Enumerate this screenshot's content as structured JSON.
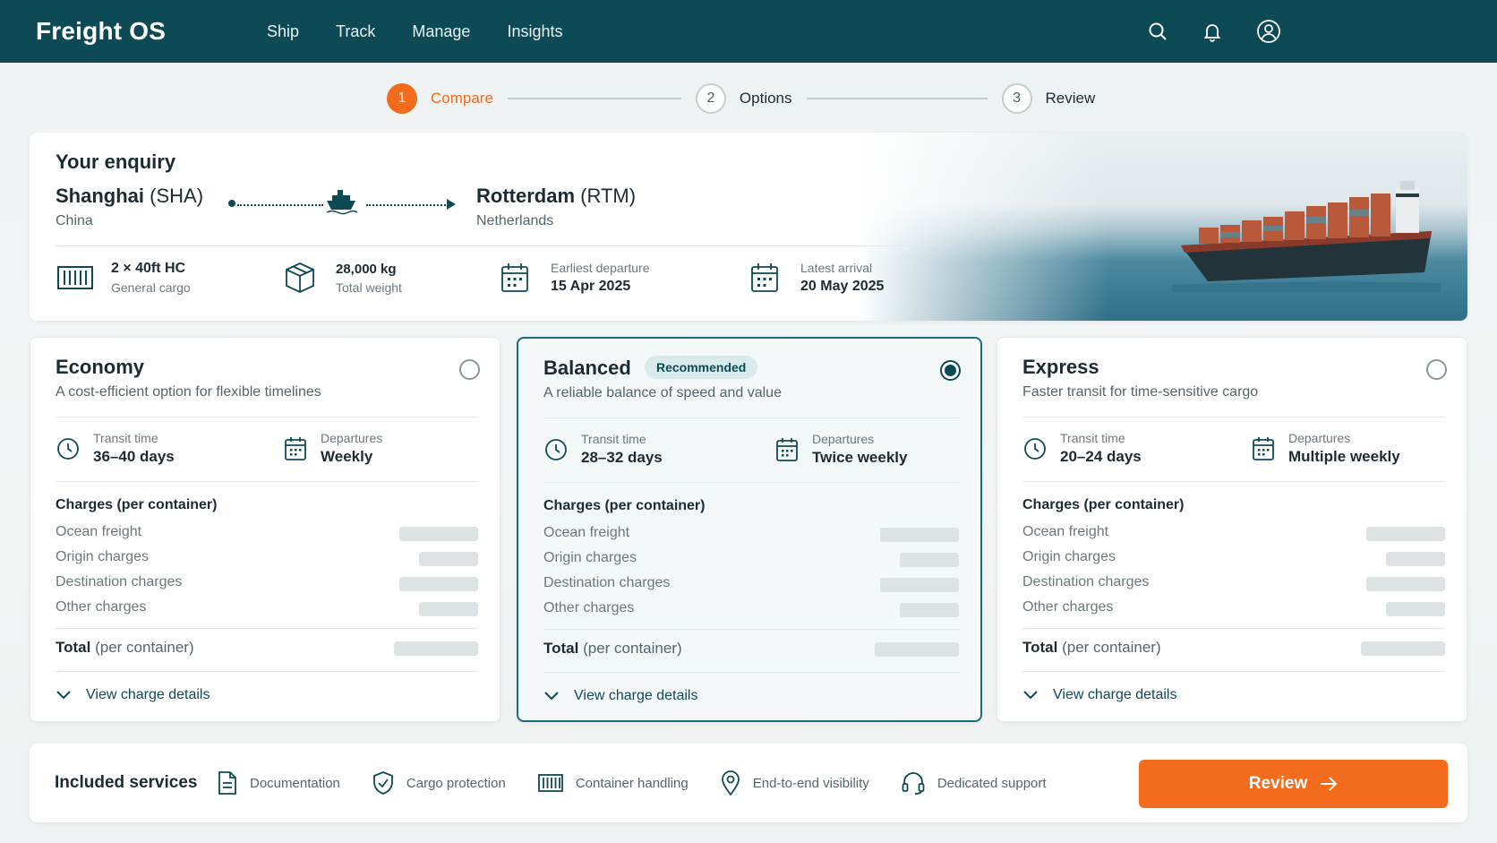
{
  "app": {
    "brand": "Freight OS"
  },
  "nav": {
    "items": [
      "Ship",
      "Track",
      "Manage",
      "Insights"
    ],
    "icons": [
      "search-icon",
      "bell-icon",
      "user-icon"
    ]
  },
  "stepper": {
    "steps": [
      {
        "number": "1",
        "label": "Compare",
        "state": "active"
      },
      {
        "number": "2",
        "label": "Options",
        "state": "inactive"
      },
      {
        "number": "3",
        "label": "Review",
        "state": "inactive"
      }
    ]
  },
  "enquiry": {
    "title": "Your enquiry",
    "origin": {
      "city": "Shanghai",
      "code": "(SHA)",
      "country": "China"
    },
    "destination": {
      "city": "Rotterdam",
      "code": "(RTM)",
      "country": "Netherlands"
    },
    "cargo": {
      "main": "2 × 40ft HC",
      "sub": "General cargo"
    },
    "weight": {
      "main": "28,000 kg",
      "sub": "Total weight"
    },
    "departure": {
      "label": "Earliest departure",
      "value": "15 Apr 2025"
    },
    "arrival": {
      "label": "Latest arrival",
      "value": "20 May 2025"
    }
  },
  "options": [
    {
      "name": "Economy",
      "badge": "",
      "selected": false,
      "description": "A cost-efficient option for flexible timelines",
      "transit_label": "Transit time",
      "transit": "36–40 days",
      "departures_label": "Departures",
      "departures": "Weekly",
      "charges_title": "Charges (per container)",
      "charges": [
        "Ocean freight",
        "Origin charges",
        "Destination charges",
        "Other charges"
      ],
      "total_bold": "Total",
      "total_rest": " (per container)",
      "details": "View charge details"
    },
    {
      "name": "Balanced",
      "badge": "Recommended",
      "selected": true,
      "description": "A reliable balance of speed and value",
      "transit_label": "Transit time",
      "transit": "28–32 days",
      "departures_label": "Departures",
      "departures": "Twice weekly",
      "charges_title": "Charges (per container)",
      "charges": [
        "Ocean freight",
        "Origin charges",
        "Destination charges",
        "Other charges"
      ],
      "total_bold": "Total",
      "total_rest": " (per container)",
      "details": "View charge details"
    },
    {
      "name": "Express",
      "badge": "",
      "selected": false,
      "description": "Faster transit for time-sensitive cargo",
      "transit_label": "Transit time",
      "transit": "20–24 days",
      "departures_label": "Departures",
      "departures": "Multiple weekly",
      "charges_title": "Charges (per container)",
      "charges": [
        "Ocean freight",
        "Origin charges",
        "Destination charges",
        "Other charges"
      ],
      "total_bold": "Total",
      "total_rest": " (per container)",
      "details": "View charge details"
    }
  ],
  "services": {
    "title": "Included services",
    "items": [
      {
        "label": "Documentation",
        "icon": "document-icon"
      },
      {
        "label": "Cargo protection",
        "icon": "shield-icon"
      },
      {
        "label": "Container handling",
        "icon": "container-icon"
      },
      {
        "label": "End-to-end visibility",
        "icon": "location-pin-icon"
      },
      {
        "label": "Dedicated support",
        "icon": "headset-icon"
      }
    ],
    "cta": "Review"
  },
  "colors": {
    "nav": "#0e4a55",
    "accent": "#f36b1c",
    "selected_border": "#1a6c7c"
  }
}
